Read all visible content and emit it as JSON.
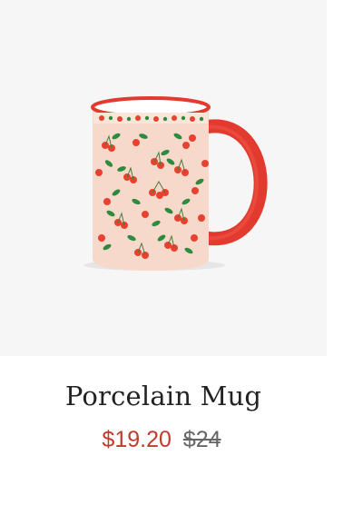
{
  "product": {
    "image_alt": "Porcelain Mug",
    "name": "Porcelain Mug",
    "sale_price": "$19.20",
    "original_price": "$24"
  },
  "colors": {
    "image_background": "#f6f6f6",
    "mug_body": "#f7d9cb",
    "mug_handle": "#e23a2f",
    "cherry": "#e8412f",
    "leaf": "#2e8b3d",
    "sale_price": "#c23a2a",
    "original_price": "#666666"
  }
}
